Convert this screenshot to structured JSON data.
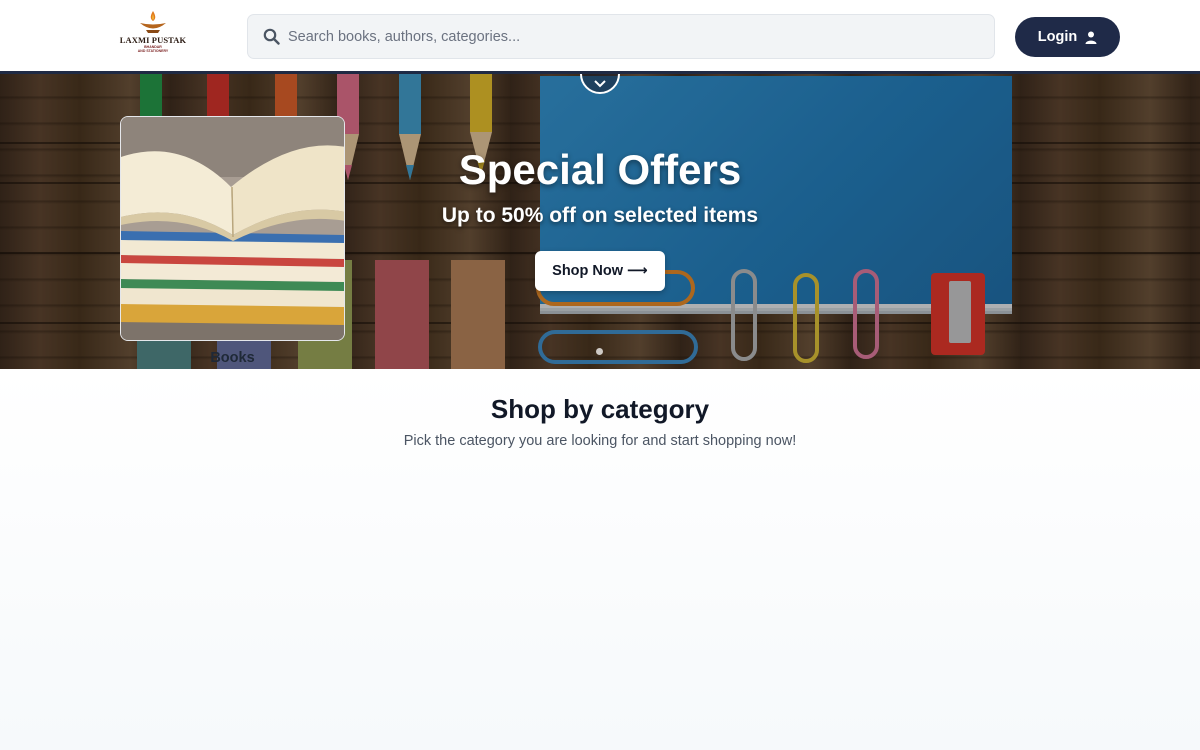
{
  "brand": {
    "logo_title": "LAXMI PUSTAK",
    "logo_line1": "BHANDAR",
    "logo_line2": "AND STATIONERY"
  },
  "header": {
    "search_placeholder": "Search books, authors, categories...",
    "login_label": "Login",
    "accent_color": "#1f2a48"
  },
  "hero": {
    "title": "Special Offers",
    "subtitle": "Up to 50% off on selected items",
    "cta_label": "Shop Now",
    "cta_arrow": "⟶"
  },
  "categories_section": {
    "title": "Shop by category",
    "subtitle": "Pick the category you are looking for and start shopping now!",
    "items": [
      {
        "label": "Books",
        "image": "open-books-stack"
      }
    ]
  },
  "icons": {
    "search": "search-icon",
    "user": "user-icon",
    "chevron": "chevron-down-icon",
    "arrow": "arrow-right-icon"
  }
}
